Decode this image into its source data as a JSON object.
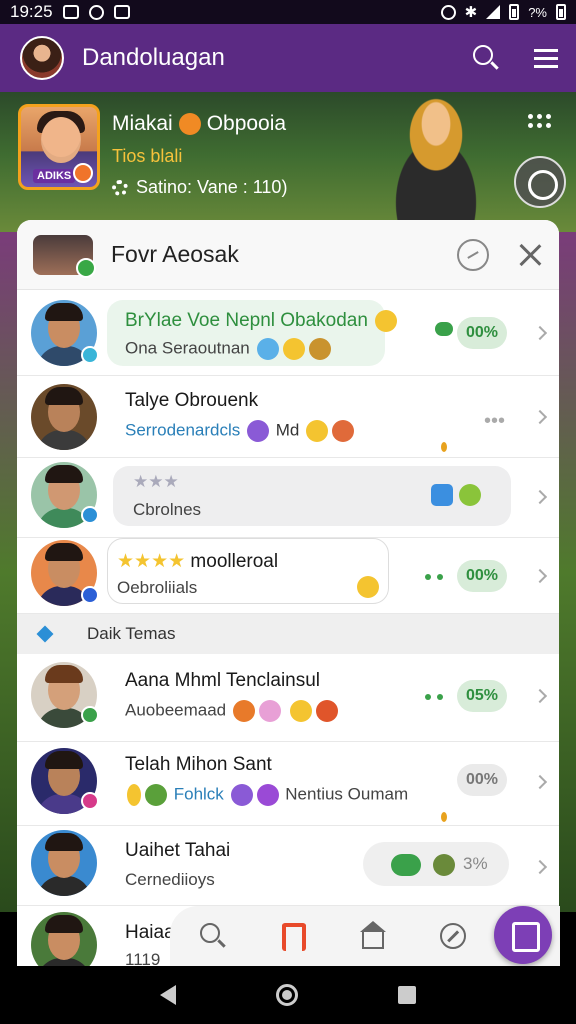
{
  "status_bar": {
    "time": "19:25",
    "right_text": "?%"
  },
  "app_bar": {
    "title": "Dandoluagan"
  },
  "hero": {
    "name_part1": "Miakai",
    "name_part2": "Obpooia",
    "subtitle": "Tios blali",
    "avatar_badge": "ADIKS",
    "status": "Satino: Vane : 110)"
  },
  "panel": {
    "title": "Fovr Aeosak",
    "section_label": "Daik Temas"
  },
  "chats": [
    {
      "name": "BrYlae Voe Nepnl Obakodan",
      "preview": "Ona Seraoutnan",
      "badge": "00%"
    },
    {
      "name": "Talye Obrouenk",
      "preview": "Serrodenardcls",
      "preview_tail": "Md"
    },
    {
      "name": "",
      "preview": "Cbrolnes"
    },
    {
      "name": "moolleroal",
      "preview": "Oebroliials",
      "badge": "00%"
    },
    {
      "name": "Aana Mhml Tenclainsul",
      "preview": "Auobeemaad",
      "badge": "05%"
    },
    {
      "name": "Telah Mihon Sant",
      "preview": "Fohlck",
      "preview_tail": "Nentius Oumam",
      "badge": "00%"
    },
    {
      "name": "Uaihet Tahai",
      "preview": "Cernediioys",
      "badge": "3%"
    },
    {
      "name": "Haiaan",
      "preview": "1119"
    }
  ],
  "colors": {
    "app_bar": "#5b2a83",
    "accent_green": "#3aa14a",
    "fab": "#7d3fb6",
    "hero_subtitle": "#f6c23b"
  },
  "icons": {
    "app_bar": [
      "search-icon",
      "menu-icon"
    ],
    "dock": [
      "search-icon",
      "music-icon",
      "home-icon",
      "compass-icon",
      "message-icon"
    ]
  }
}
